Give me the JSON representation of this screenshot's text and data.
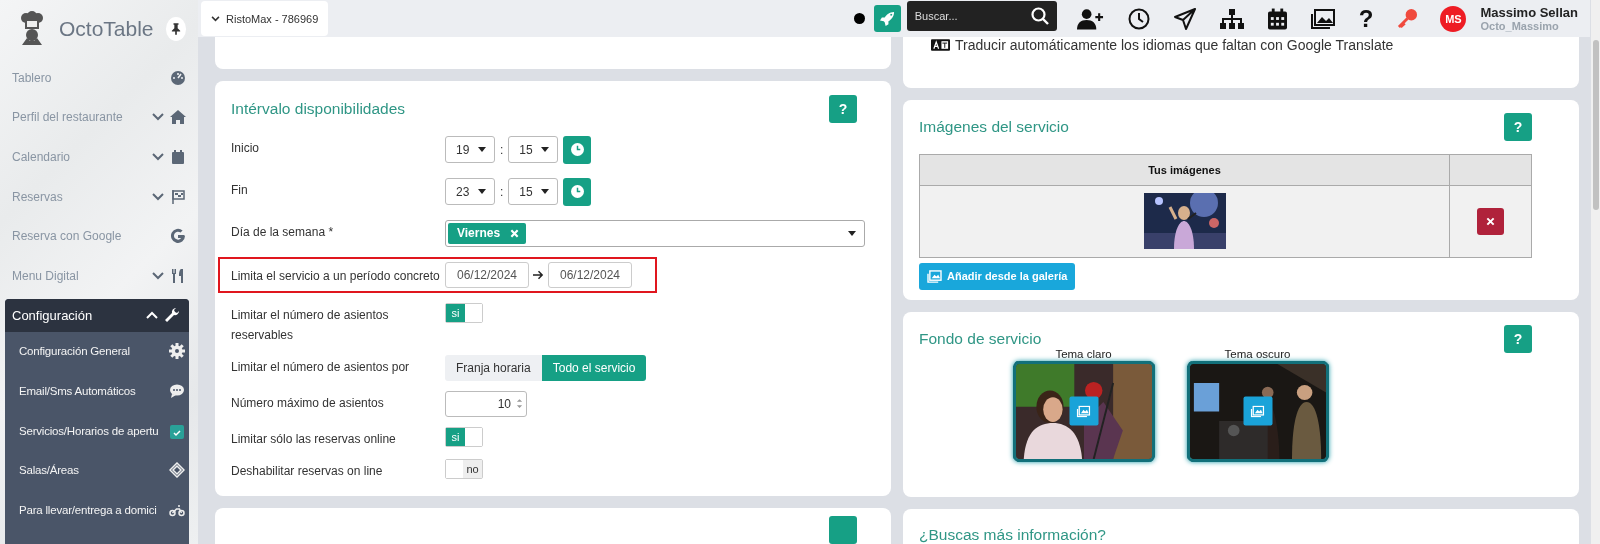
{
  "sidebar": {
    "brand": "OctoTable",
    "items": [
      {
        "label": "Tablero",
        "kind": "link"
      },
      {
        "label": "Perfil del restaurante",
        "kind": "group",
        "expanded": false
      },
      {
        "label": "Calendario",
        "kind": "group",
        "expanded": false
      },
      {
        "label": "Reservas",
        "kind": "group",
        "expanded": false
      },
      {
        "label": "Reserva con Google",
        "kind": "link"
      },
      {
        "label": "Menu Digital",
        "kind": "group",
        "expanded": false
      },
      {
        "label": "Configuración",
        "kind": "group",
        "expanded": true,
        "children": [
          {
            "label": "Configuración General",
            "selected": false
          },
          {
            "label": "Email/Sms Automáticos",
            "selected": false
          },
          {
            "label": "Servicios/Horarios de apertu",
            "selected": true
          },
          {
            "label": "Salas/Áreas",
            "selected": false
          },
          {
            "label": "Para llevar/entrega a domici",
            "selected": false
          }
        ]
      }
    ]
  },
  "topbar": {
    "restaurant": "RistoMax - 786969",
    "search": {
      "placeholder": "Buscar..."
    },
    "help_glyph": "?",
    "user": {
      "initials": "MS",
      "name": "Massimo Sellan",
      "username": "Octo_Massimo"
    }
  },
  "left_cards": [
    {
      "kind": "blank"
    },
    {
      "kind": "fields",
      "title": "Intérvalo disponibilidades",
      "help": "?",
      "rows": [
        {
          "kind": "time",
          "label": "Inicio",
          "hour": "19",
          "separator": ":",
          "minute": "15"
        },
        {
          "kind": "time",
          "label": "Fin",
          "hour": "23",
          "separator": ":",
          "minute": "15"
        },
        {
          "kind": "tags",
          "label": "Día de la semana *",
          "tags": [
            "Viernes"
          ]
        },
        {
          "kind": "daterange",
          "label": "Limita el servicio a un período concreto",
          "from": "06/12/2024",
          "to": "06/12/2024",
          "highlighted": true
        },
        {
          "kind": "toggle",
          "label": "Limitar el número de asientos reservables",
          "on": true,
          "text": "si"
        },
        {
          "kind": "segmented",
          "label": "Limitar el número de asientos por",
          "options": [
            {
              "label": "Franja horaria",
              "selected": false
            },
            {
              "label": "Todo el servicio",
              "selected": true
            }
          ]
        },
        {
          "kind": "number",
          "label": "Número máximo de asientos",
          "value": "10"
        },
        {
          "kind": "toggle",
          "label": "Limitar sólo las reservas online",
          "on": true,
          "text": "si"
        },
        {
          "kind": "toggle",
          "label": "Deshabilitar reservas on line",
          "on": false,
          "text": "no"
        }
      ]
    },
    {
      "kind": "stub"
    }
  ],
  "right_cards": [
    {
      "kind": "translate",
      "text": "Traducir automáticamente los idiomas que faltan con Google Translate"
    },
    {
      "kind": "images",
      "title": "Imágenes del servicio",
      "help": "?",
      "column": "Tus imágenes",
      "add_button": "Añadir desde la galería"
    },
    {
      "kind": "themes",
      "title": "Fondo de servicio",
      "help": "?",
      "themes": [
        {
          "label": "Tema claro"
        },
        {
          "label": "Tema oscuro"
        }
      ]
    },
    {
      "kind": "info",
      "title": "¿Buscas más información?"
    }
  ]
}
